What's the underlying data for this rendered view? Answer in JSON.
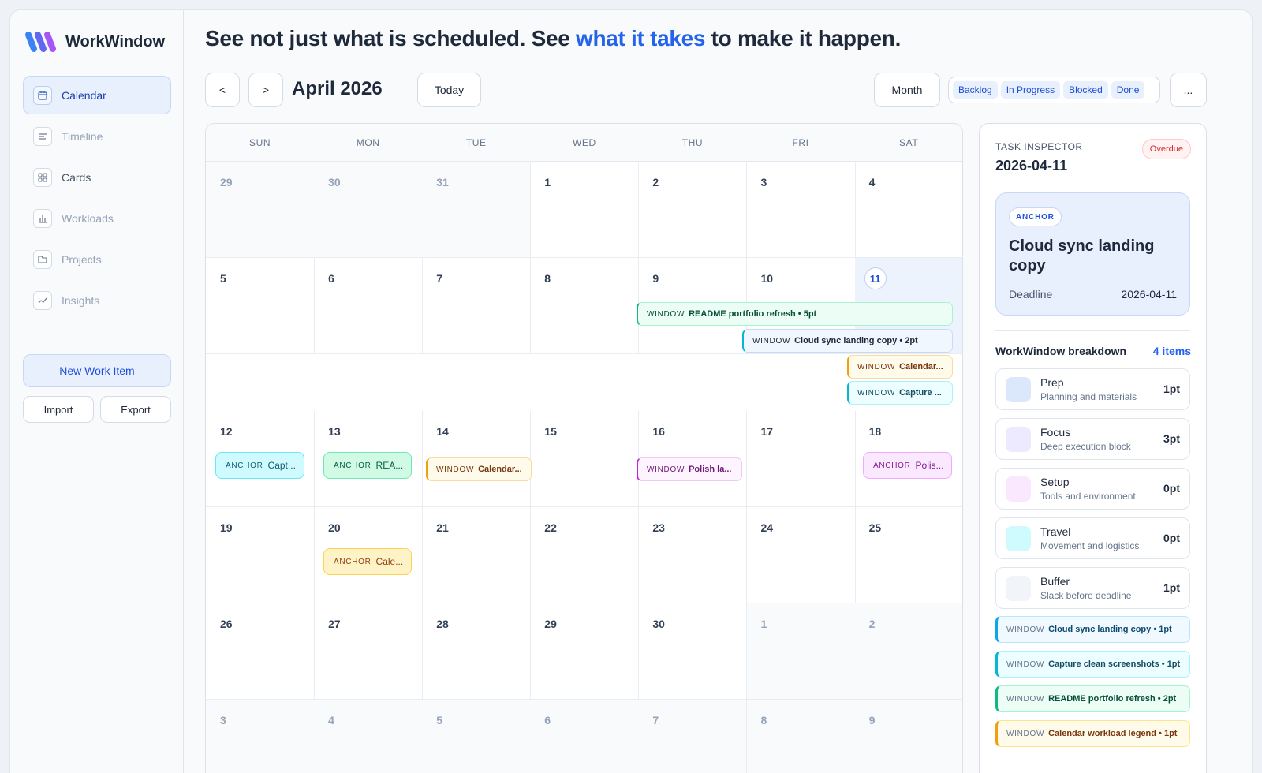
{
  "brand": {
    "name": "WorkWindow"
  },
  "nav": [
    {
      "label": "Calendar",
      "icon": "calendar-icon",
      "state": "active"
    },
    {
      "label": "Timeline",
      "icon": "timeline-icon",
      "state": "muted"
    },
    {
      "label": "Cards",
      "icon": "cards-icon",
      "state": "dark"
    },
    {
      "label": "Workloads",
      "icon": "bar-chart-icon",
      "state": "muted"
    },
    {
      "label": "Projects",
      "icon": "folder-icon",
      "state": "muted"
    },
    {
      "label": "Insights",
      "icon": "trend-icon",
      "state": "muted"
    }
  ],
  "actions": {
    "new_item": "New Work Item",
    "import": "Import",
    "export": "Export"
  },
  "headline": {
    "part1": "See not just what is scheduled. See ",
    "accent": "what it takes",
    "part2": " to make it happen."
  },
  "toolbar": {
    "prev": "<",
    "next": ">",
    "month_title": "April 2026",
    "today": "Today",
    "view": "Month",
    "more": "...",
    "statuses": [
      "Backlog",
      "In Progress",
      "Blocked",
      "Done"
    ]
  },
  "calendar": {
    "weekdays": [
      "SUN",
      "MON",
      "TUE",
      "WED",
      "THU",
      "FRI",
      "SAT"
    ],
    "today": "11",
    "weeks": [
      [
        {
          "d": "29",
          "m": true
        },
        {
          "d": "30",
          "m": true
        },
        {
          "d": "31",
          "m": true
        },
        {
          "d": "1"
        },
        {
          "d": "2"
        },
        {
          "d": "3"
        },
        {
          "d": "4"
        }
      ],
      [
        {
          "d": "5"
        },
        {
          "d": "6"
        },
        {
          "d": "7"
        },
        {
          "d": "8"
        },
        {
          "d": "9"
        },
        {
          "d": "10"
        },
        {
          "d": "11",
          "t": true
        }
      ],
      [
        {
          "d": "12"
        },
        {
          "d": "13"
        },
        {
          "d": "14"
        },
        {
          "d": "15"
        },
        {
          "d": "16"
        },
        {
          "d": "17"
        },
        {
          "d": "18"
        }
      ],
      [
        {
          "d": "19"
        },
        {
          "d": "20"
        },
        {
          "d": "21"
        },
        {
          "d": "22"
        },
        {
          "d": "23"
        },
        {
          "d": "24"
        },
        {
          "d": "25"
        }
      ],
      [
        {
          "d": "26"
        },
        {
          "d": "27"
        },
        {
          "d": "28"
        },
        {
          "d": "29"
        },
        {
          "d": "30"
        },
        {
          "d": "1",
          "m": true
        },
        {
          "d": "2",
          "m": true
        }
      ],
      [
        {
          "d": "3",
          "m": true
        },
        {
          "d": "4",
          "m": true
        },
        {
          "d": "5",
          "m": true
        },
        {
          "d": "6",
          "m": true
        },
        {
          "d": "7",
          "m": true
        },
        {
          "d": "8",
          "m": true
        },
        {
          "d": "9",
          "m": true
        }
      ]
    ],
    "window_tag": "WINDOW",
    "anchor_tag": "ANCHOR",
    "events": {
      "readme_bar": "README portfolio refresh • 5pt",
      "cloud_bar": "Cloud sync landing copy • 2pt",
      "calendar_bar": "Calendar...",
      "capture_bar": "Capture ...",
      "anchor_12": "Capt...",
      "anchor_13": "REA...",
      "window_14": "Calendar...",
      "window_16": "Polish la...",
      "anchor_18": "Polis...",
      "anchor_20": "Cale..."
    }
  },
  "inspector": {
    "label": "TASK INSPECTOR",
    "date": "2026-04-11",
    "badge": "Overdue",
    "anchor_pill": "ANCHOR",
    "title": "Cloud sync landing copy",
    "deadline_label": "Deadline",
    "deadline_value": "2026-04-11",
    "breakdown_title": "WorkWindow breakdown",
    "breakdown_count": "4 items",
    "breakdown": [
      {
        "name": "Prep",
        "desc": "Planning and materials",
        "pts": "1pt",
        "color": "#dbe7fb"
      },
      {
        "name": "Focus",
        "desc": "Deep execution block",
        "pts": "3pt",
        "color": "#ede9fe"
      },
      {
        "name": "Setup",
        "desc": "Tools and environment",
        "pts": "0pt",
        "color": "#fae8ff"
      },
      {
        "name": "Travel",
        "desc": "Movement and logistics",
        "pts": "0pt",
        "color": "#cffafe"
      },
      {
        "name": "Buffer",
        "desc": "Slack before deadline",
        "pts": "1pt",
        "color": "#f1f5f9"
      }
    ],
    "window_tag": "WINDOW",
    "windows": [
      {
        "title": "Cloud sync landing copy • 1pt",
        "kind": "blue"
      },
      {
        "title": "Capture clean screenshots • 1pt",
        "kind": "cyan"
      },
      {
        "title": "README portfolio refresh • 2pt",
        "kind": "green"
      },
      {
        "title": "Calendar workload legend • 1pt",
        "kind": "amber"
      }
    ]
  }
}
